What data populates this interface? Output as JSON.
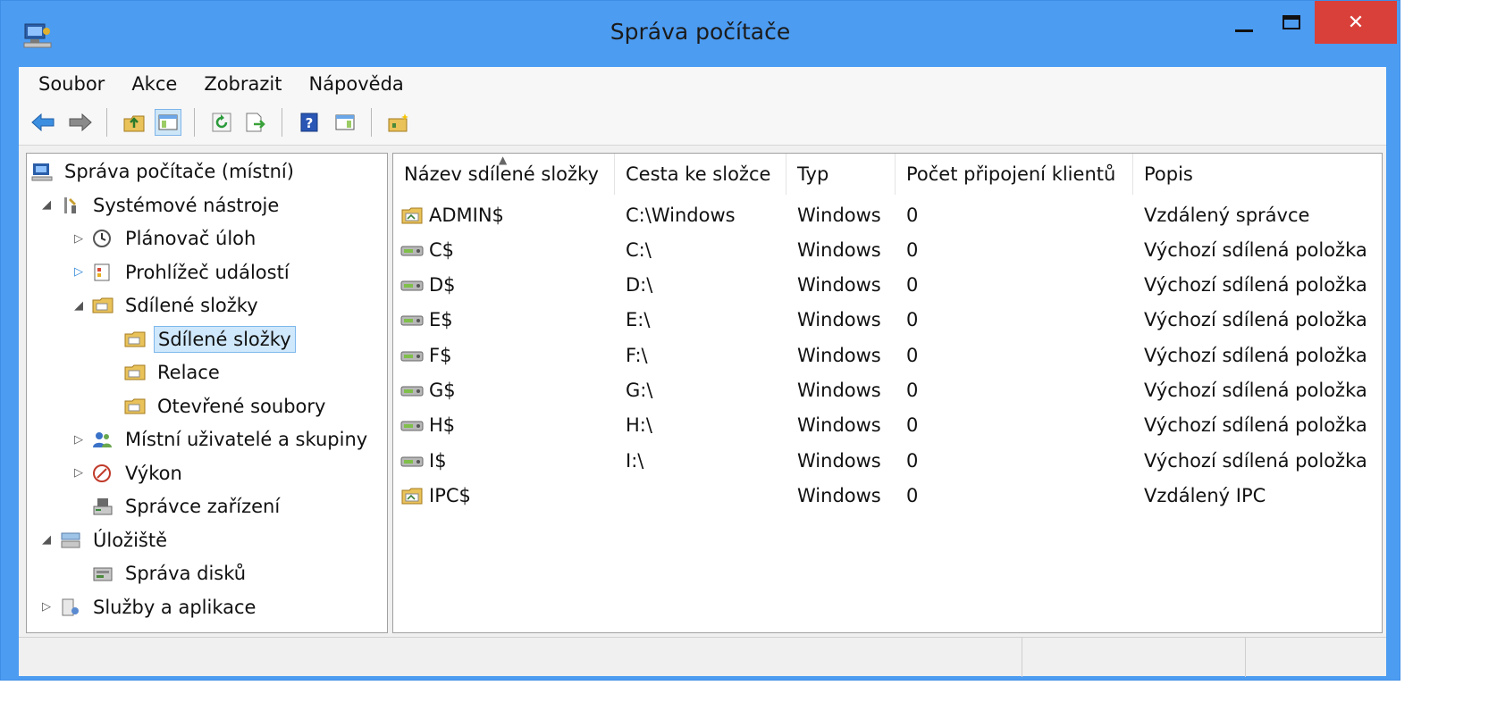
{
  "window": {
    "title": "Správa počítače"
  },
  "menu": [
    "Soubor",
    "Akce",
    "Zobrazit",
    "Nápověda"
  ],
  "toolbar": {
    "icons": [
      "back-arrow-icon",
      "forward-arrow-icon",
      "up-folder-icon",
      "show-hide-tree-icon",
      "refresh-icon",
      "export-list-icon",
      "help-icon",
      "show-hide-action-pane-icon",
      "new-share-icon"
    ]
  },
  "tree": [
    {
      "label": "Správa počítače (místní)",
      "icon": "computer-management-icon",
      "expander": "",
      "level": 0
    },
    {
      "label": "Systémové nástroje",
      "icon": "system-tools-icon",
      "expander": "expanded",
      "level": 1
    },
    {
      "label": "Plánovač úloh",
      "icon": "clock-icon",
      "expander": "collapsed",
      "level": 2
    },
    {
      "label": "Prohlížeč událostí",
      "icon": "event-viewer-icon",
      "expander": "collapsed-blue",
      "level": 2
    },
    {
      "label": "Sdílené složky",
      "icon": "shared-folder-icon",
      "expander": "expanded",
      "level": 2
    },
    {
      "label": "Sdílené složky",
      "icon": "shared-folder-icon",
      "expander": "",
      "level": 3,
      "selected": true
    },
    {
      "label": "Relace",
      "icon": "shared-folder-icon",
      "expander": "",
      "level": 3
    },
    {
      "label": "Otevřené soubory",
      "icon": "shared-folder-icon",
      "expander": "",
      "level": 3
    },
    {
      "label": "Místní uživatelé a skupiny",
      "icon": "users-icon",
      "expander": "collapsed",
      "level": 2
    },
    {
      "label": "Výkon",
      "icon": "performance-icon",
      "expander": "collapsed",
      "level": 2
    },
    {
      "label": "Správce zařízení",
      "icon": "device-manager-icon",
      "expander": "",
      "level": 2
    },
    {
      "label": "Úložiště",
      "icon": "storage-icon",
      "expander": "expanded",
      "level": 1
    },
    {
      "label": "Správa disků",
      "icon": "disk-management-icon",
      "expander": "",
      "level": 2
    },
    {
      "label": "Služby a aplikace",
      "icon": "services-icon",
      "expander": "collapsed",
      "level": 1
    }
  ],
  "list": {
    "columns": [
      "Název sdílené složky",
      "Cesta ke složce",
      "Typ",
      "Počet připojení klientů",
      "Popis"
    ],
    "rows": [
      {
        "name": "ADMIN$",
        "path": "C:\\Windows",
        "type": "Windows",
        "clients": "0",
        "desc": "Vzdálený správce",
        "icon": "shared-folder-icon"
      },
      {
        "name": "C$",
        "path": "C:\\",
        "type": "Windows",
        "clients": "0",
        "desc": "Výchozí sdílená položka",
        "icon": "shared-drive-icon"
      },
      {
        "name": "D$",
        "path": "D:\\",
        "type": "Windows",
        "clients": "0",
        "desc": "Výchozí sdílená položka",
        "icon": "shared-drive-icon"
      },
      {
        "name": "E$",
        "path": "E:\\",
        "type": "Windows",
        "clients": "0",
        "desc": "Výchozí sdílená položka",
        "icon": "shared-drive-icon"
      },
      {
        "name": "F$",
        "path": "F:\\",
        "type": "Windows",
        "clients": "0",
        "desc": "Výchozí sdílená položka",
        "icon": "shared-drive-icon"
      },
      {
        "name": "G$",
        "path": "G:\\",
        "type": "Windows",
        "clients": "0",
        "desc": "Výchozí sdílená položka",
        "icon": "shared-drive-icon"
      },
      {
        "name": "H$",
        "path": "H:\\",
        "type": "Windows",
        "clients": "0",
        "desc": "Výchozí sdílená položka",
        "icon": "shared-drive-icon"
      },
      {
        "name": "I$",
        "path": "I:\\",
        "type": "Windows",
        "clients": "0",
        "desc": "Výchozí sdílená položka",
        "icon": "shared-drive-icon"
      },
      {
        "name": "IPC$",
        "path": "",
        "type": "Windows",
        "clients": "0",
        "desc": "Vzdálený IPC",
        "icon": "shared-folder-icon"
      }
    ]
  },
  "colors": {
    "titlebar": "#4c9cf2",
    "close": "#d9403a",
    "selection": "#d0e8fb"
  }
}
